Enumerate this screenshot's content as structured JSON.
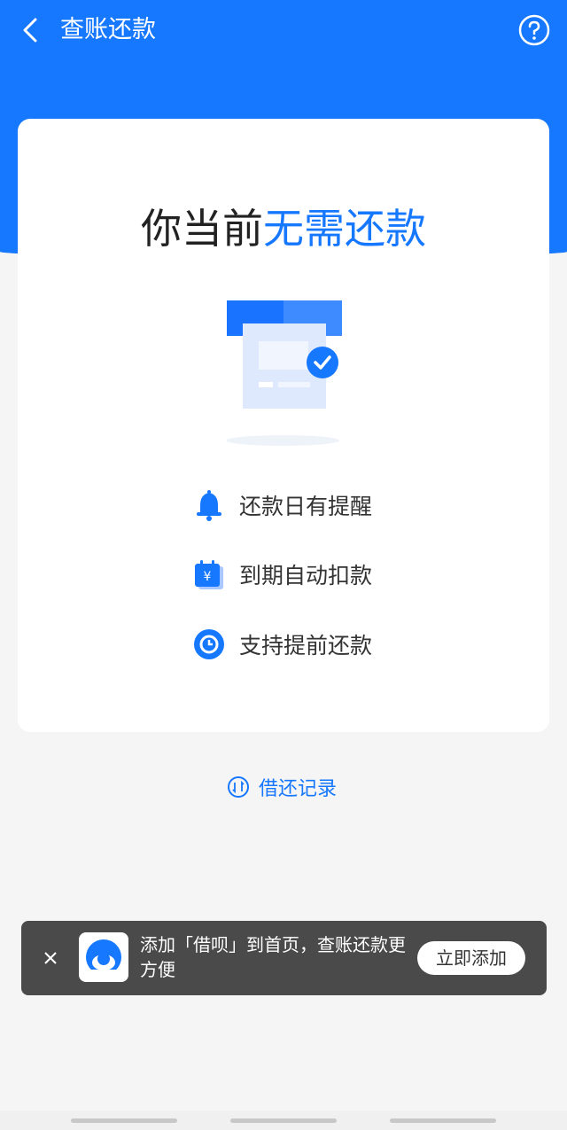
{
  "header": {
    "title": "查账还款"
  },
  "card": {
    "headline_prefix": "你当前",
    "headline_accent": "无需还款",
    "features": [
      {
        "label": "还款日有提醒",
        "icon": "bell-icon"
      },
      {
        "label": "到期自动扣款",
        "icon": "calendar-yen-icon"
      },
      {
        "label": "支持提前还款",
        "icon": "clock-icon"
      }
    ]
  },
  "records": {
    "label": "借还记录"
  },
  "banner": {
    "text": "添加「借呗」到首页，查账还款更方便",
    "button": "立即添加"
  },
  "colors": {
    "primary": "#1677ff",
    "banner_bg": "#4a4a4a"
  }
}
